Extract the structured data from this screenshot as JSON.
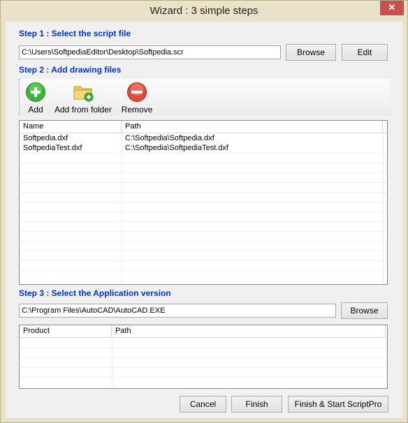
{
  "window": {
    "title": "Wizard : 3 simple steps",
    "close_glyph": "✕"
  },
  "step1": {
    "label": "Step 1 : Select the script file",
    "path": "C:\\Users\\SoftpediaEditor\\Desktop\\Softpedia.scr",
    "browse": "Browse",
    "edit": "Edit"
  },
  "step2": {
    "label": "Step 2 : Add drawing files",
    "toolbar": {
      "add": "Add",
      "add_folder": "Add from folder",
      "remove": "Remove"
    },
    "columns": [
      "Name",
      "Path"
    ],
    "rows": [
      {
        "name": "Softpedia.dxf",
        "path": "C:\\Softpedia\\Softpedia.dxf"
      },
      {
        "name": "SoftpediaTest.dxf",
        "path": "C:\\Softpedia\\SoftpediaTest.dxf"
      }
    ]
  },
  "step3": {
    "label": "Step 3 : Select the Application version",
    "path": "C:\\Program Files\\AutoCAD\\AutoCAD.EXE",
    "browse": "Browse",
    "columns": [
      "Product",
      "Path"
    ]
  },
  "footer": {
    "cancel": "Cancel",
    "finish": "Finish",
    "finish_start": "Finish & Start ScriptPro"
  },
  "colors": {
    "step_label": "#0033cc",
    "add_green": "#3db33d",
    "remove_red": "#e04a3a",
    "folder_yellow": "#f1c552"
  }
}
